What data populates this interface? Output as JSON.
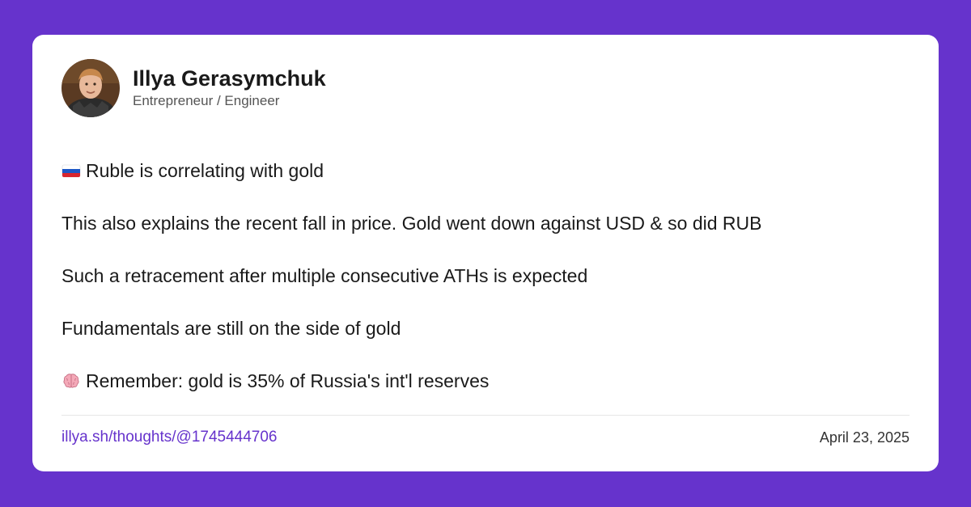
{
  "colors": {
    "background": "#6633cc",
    "card": "#ffffff",
    "link": "#6633cc",
    "text": "#1a1a1a"
  },
  "author": {
    "name": "Illya Gerasymchuk",
    "role": "Entrepreneur / Engineer",
    "avatar_icon": "profile-photo"
  },
  "post": {
    "lines": [
      {
        "emoji": "russia-flag-icon",
        "text": "Ruble is correlating with gold"
      },
      {
        "emoji": "",
        "text": "This also explains the recent fall in price. Gold went down against USD & so did RUB"
      },
      {
        "emoji": "",
        "text": "Such a retracement after multiple consecutive ATHs is expected"
      },
      {
        "emoji": "",
        "text": "Fundamentals are still on the side of gold"
      },
      {
        "emoji": "brain-icon",
        "text": "Remember: gold is 35% of Russia's int'l reserves"
      }
    ]
  },
  "footer": {
    "link": "illya.sh/thoughts/@1745444706",
    "date": "April 23, 2025"
  }
}
